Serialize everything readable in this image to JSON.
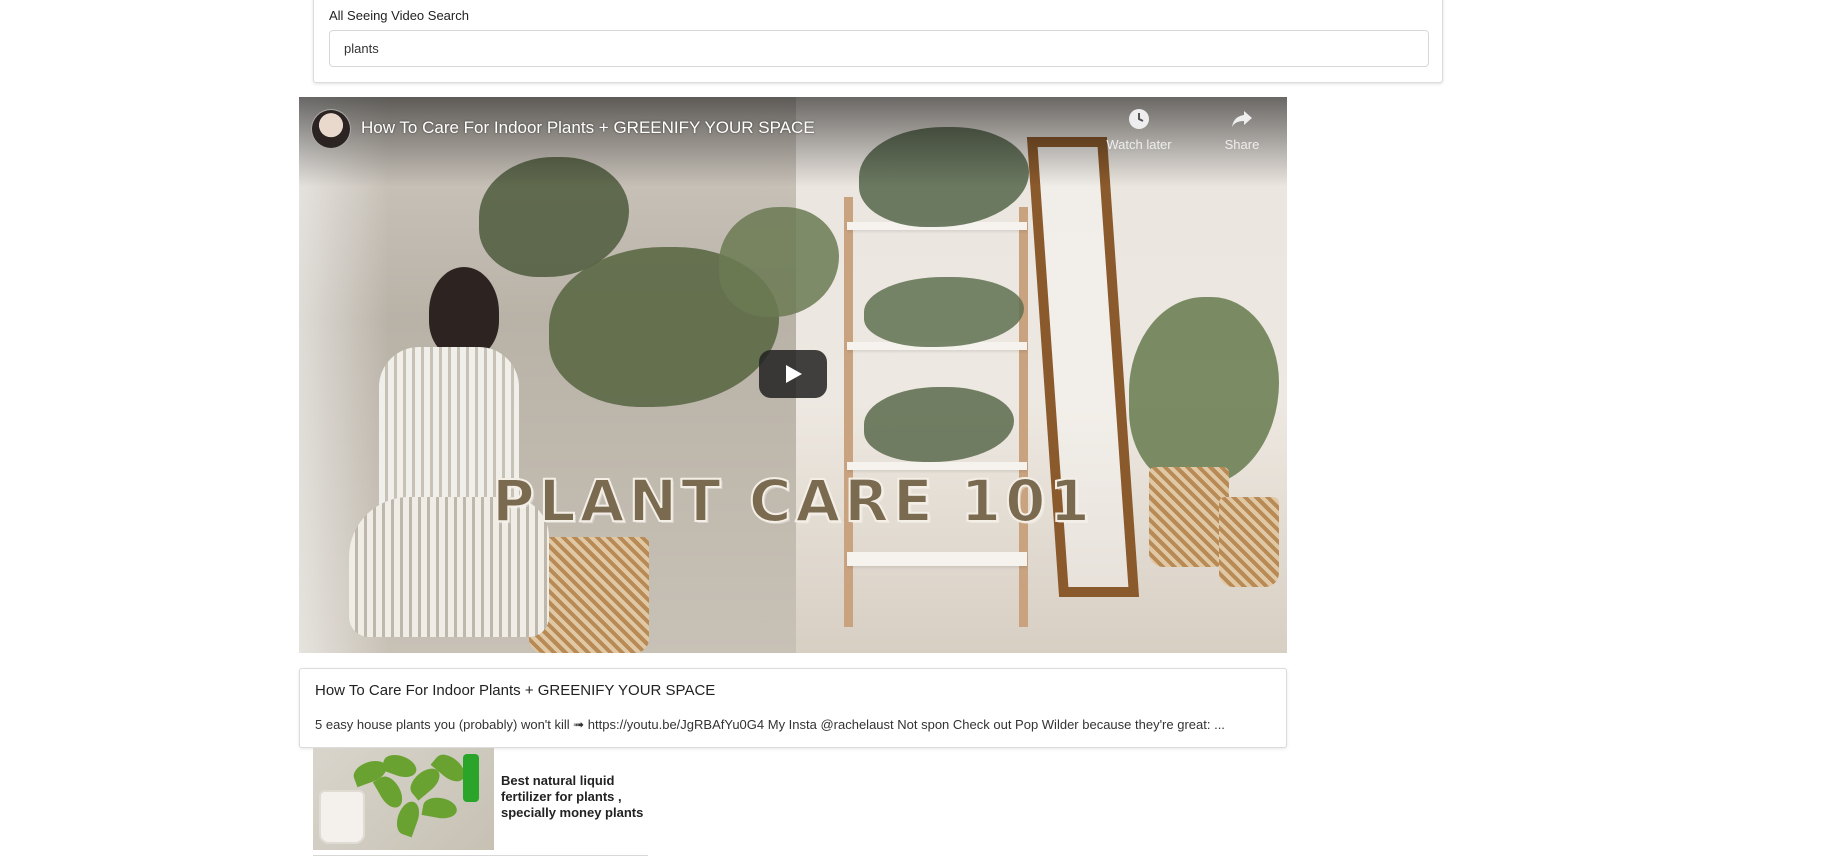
{
  "search": {
    "label": "All Seeing Video Search",
    "value": "plants"
  },
  "player": {
    "title": "How To Care For Indoor Plants + GREENIFY YOUR SPACE",
    "watch_later_label": "Watch later",
    "share_label": "Share",
    "overlay_text": "PLANT CARE 101",
    "icons": {
      "watch_later": "clock-icon",
      "share": "share-arrow-icon",
      "play": "play-icon"
    }
  },
  "info": {
    "title": "How To Care For Indoor Plants + GREENIFY YOUR SPACE",
    "description": "5 easy house plants you (probably) won't kill ➟ https://youtu.be/JgRBAfYu0G4 My Insta @rachelaust Not spon Check out Pop Wilder because they're great: ..."
  },
  "related": [
    {
      "title": "Best natural liquid fertilizer for plants , specially money plants"
    }
  ]
}
